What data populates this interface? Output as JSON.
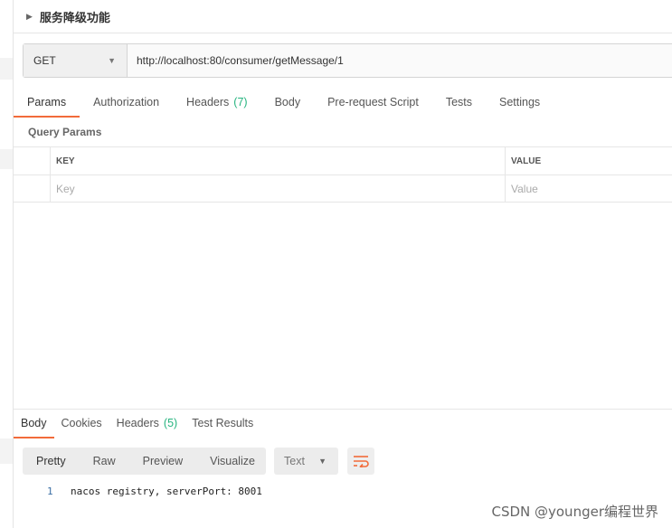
{
  "collection": {
    "name": "服务降级功能"
  },
  "request": {
    "method": "GET",
    "url": "http://localhost:80/consumer/getMessage/1"
  },
  "request_tabs": [
    {
      "label": "Params",
      "count": "",
      "active": true
    },
    {
      "label": "Authorization",
      "count": ""
    },
    {
      "label": "Headers",
      "count": "(7)"
    },
    {
      "label": "Body",
      "count": ""
    },
    {
      "label": "Pre-request Script",
      "count": ""
    },
    {
      "label": "Tests",
      "count": ""
    },
    {
      "label": "Settings",
      "count": ""
    }
  ],
  "query_params": {
    "title": "Query Params",
    "key_header": "KEY",
    "value_header": "VALUE",
    "key_placeholder": "Key",
    "value_placeholder": "Value"
  },
  "response_tabs": [
    {
      "label": "Body",
      "count": "",
      "active": true
    },
    {
      "label": "Cookies",
      "count": ""
    },
    {
      "label": "Headers",
      "count": "(5)"
    },
    {
      "label": "Test Results",
      "count": ""
    }
  ],
  "view_modes": [
    "Pretty",
    "Raw",
    "Preview",
    "Visualize"
  ],
  "format": "Text",
  "response_body": [
    {
      "line": "1",
      "text": "nacos registry, serverPort: 8001"
    }
  ],
  "watermark": "CSDN @younger编程世界",
  "colors": {
    "accent": "#f26b3a",
    "count": "#26b47f"
  }
}
